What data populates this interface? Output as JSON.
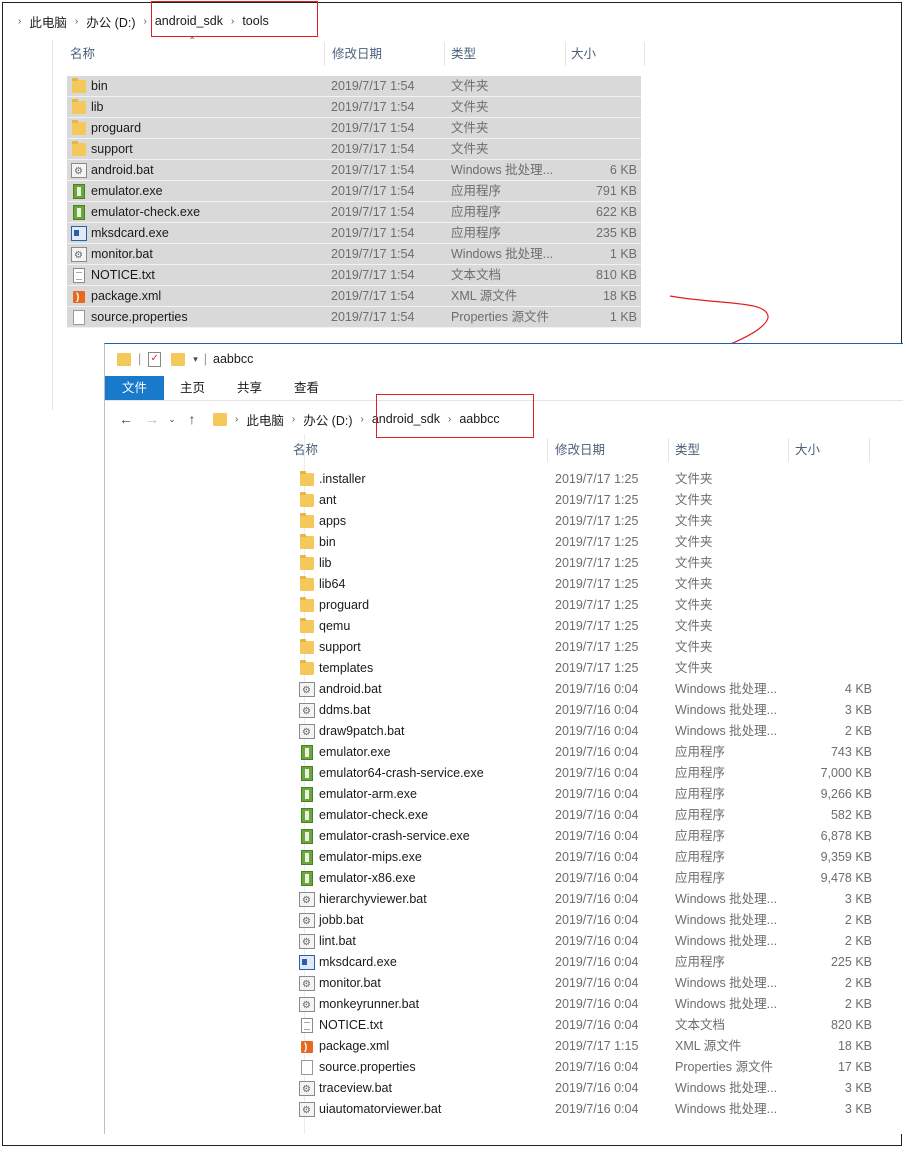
{
  "window1": {
    "breadcrumb": [
      "此电脑",
      "办公 (D:)",
      "android_sdk",
      "tools"
    ],
    "columns": {
      "name": "名称",
      "date": "修改日期",
      "type": "类型",
      "size": "大小"
    },
    "files": [
      {
        "icon": "folder",
        "name": "bin",
        "date": "2019/7/17 1:54",
        "type": "文件夹",
        "size": ""
      },
      {
        "icon": "folder",
        "name": "lib",
        "date": "2019/7/17 1:54",
        "type": "文件夹",
        "size": ""
      },
      {
        "icon": "folder",
        "name": "proguard",
        "date": "2019/7/17 1:54",
        "type": "文件夹",
        "size": ""
      },
      {
        "icon": "folder",
        "name": "support",
        "date": "2019/7/17 1:54",
        "type": "文件夹",
        "size": ""
      },
      {
        "icon": "bat",
        "name": "android.bat",
        "date": "2019/7/17 1:54",
        "type": "Windows 批处理...",
        "size": "6 KB"
      },
      {
        "icon": "exe",
        "name": "emulator.exe",
        "date": "2019/7/17 1:54",
        "type": "应用程序",
        "size": "791 KB"
      },
      {
        "icon": "exe",
        "name": "emulator-check.exe",
        "date": "2019/7/17 1:54",
        "type": "应用程序",
        "size": "622 KB"
      },
      {
        "icon": "exe2",
        "name": "mksdcard.exe",
        "date": "2019/7/17 1:54",
        "type": "应用程序",
        "size": "235 KB"
      },
      {
        "icon": "bat",
        "name": "monitor.bat",
        "date": "2019/7/17 1:54",
        "type": "Windows 批处理...",
        "size": "1 KB"
      },
      {
        "icon": "txt",
        "name": "NOTICE.txt",
        "date": "2019/7/17 1:54",
        "type": "文本文档",
        "size": "810 KB"
      },
      {
        "icon": "xml",
        "name": "package.xml",
        "date": "2019/7/17 1:54",
        "type": "XML 源文件",
        "size": "18 KB"
      },
      {
        "icon": "doc",
        "name": "source.properties",
        "date": "2019/7/17 1:54",
        "type": "Properties 源文件",
        "size": "1 KB"
      }
    ]
  },
  "window2": {
    "title": "aabbcc",
    "ribbon_tabs": [
      "文件",
      "主页",
      "共享",
      "查看"
    ],
    "breadcrumb": [
      "此电脑",
      "办公 (D:)",
      "android_sdk",
      "aabbcc"
    ],
    "columns": {
      "name": "名称",
      "date": "修改日期",
      "type": "类型",
      "size": "大小"
    },
    "files": [
      {
        "icon": "folder",
        "name": ".installer",
        "date": "2019/7/17 1:25",
        "type": "文件夹",
        "size": ""
      },
      {
        "icon": "folder",
        "name": "ant",
        "date": "2019/7/17 1:25",
        "type": "文件夹",
        "size": ""
      },
      {
        "icon": "folder",
        "name": "apps",
        "date": "2019/7/17 1:25",
        "type": "文件夹",
        "size": ""
      },
      {
        "icon": "folder",
        "name": "bin",
        "date": "2019/7/17 1:25",
        "type": "文件夹",
        "size": ""
      },
      {
        "icon": "folder",
        "name": "lib",
        "date": "2019/7/17 1:25",
        "type": "文件夹",
        "size": ""
      },
      {
        "icon": "folder",
        "name": "lib64",
        "date": "2019/7/17 1:25",
        "type": "文件夹",
        "size": ""
      },
      {
        "icon": "folder",
        "name": "proguard",
        "date": "2019/7/17 1:25",
        "type": "文件夹",
        "size": ""
      },
      {
        "icon": "folder",
        "name": "qemu",
        "date": "2019/7/17 1:25",
        "type": "文件夹",
        "size": ""
      },
      {
        "icon": "folder",
        "name": "support",
        "date": "2019/7/17 1:25",
        "type": "文件夹",
        "size": ""
      },
      {
        "icon": "folder",
        "name": "templates",
        "date": "2019/7/17 1:25",
        "type": "文件夹",
        "size": ""
      },
      {
        "icon": "bat",
        "name": "android.bat",
        "date": "2019/7/16 0:04",
        "type": "Windows 批处理...",
        "size": "4 KB"
      },
      {
        "icon": "bat",
        "name": "ddms.bat",
        "date": "2019/7/16 0:04",
        "type": "Windows 批处理...",
        "size": "3 KB"
      },
      {
        "icon": "bat",
        "name": "draw9patch.bat",
        "date": "2019/7/16 0:04",
        "type": "Windows 批处理...",
        "size": "2 KB"
      },
      {
        "icon": "exe",
        "name": "emulator.exe",
        "date": "2019/7/16 0:04",
        "type": "应用程序",
        "size": "743 KB"
      },
      {
        "icon": "exe",
        "name": "emulator64-crash-service.exe",
        "date": "2019/7/16 0:04",
        "type": "应用程序",
        "size": "7,000 KB"
      },
      {
        "icon": "exe",
        "name": "emulator-arm.exe",
        "date": "2019/7/16 0:04",
        "type": "应用程序",
        "size": "9,266 KB"
      },
      {
        "icon": "exe",
        "name": "emulator-check.exe",
        "date": "2019/7/16 0:04",
        "type": "应用程序",
        "size": "582 KB"
      },
      {
        "icon": "exe",
        "name": "emulator-crash-service.exe",
        "date": "2019/7/16 0:04",
        "type": "应用程序",
        "size": "6,878 KB"
      },
      {
        "icon": "exe",
        "name": "emulator-mips.exe",
        "date": "2019/7/16 0:04",
        "type": "应用程序",
        "size": "9,359 KB"
      },
      {
        "icon": "exe",
        "name": "emulator-x86.exe",
        "date": "2019/7/16 0:04",
        "type": "应用程序",
        "size": "9,478 KB"
      },
      {
        "icon": "bat",
        "name": "hierarchyviewer.bat",
        "date": "2019/7/16 0:04",
        "type": "Windows 批处理...",
        "size": "3 KB"
      },
      {
        "icon": "bat",
        "name": "jobb.bat",
        "date": "2019/7/16 0:04",
        "type": "Windows 批处理...",
        "size": "2 KB"
      },
      {
        "icon": "bat",
        "name": "lint.bat",
        "date": "2019/7/16 0:04",
        "type": "Windows 批处理...",
        "size": "2 KB"
      },
      {
        "icon": "exe2",
        "name": "mksdcard.exe",
        "date": "2019/7/16 0:04",
        "type": "应用程序",
        "size": "225 KB"
      },
      {
        "icon": "bat",
        "name": "monitor.bat",
        "date": "2019/7/16 0:04",
        "type": "Windows 批处理...",
        "size": "2 KB"
      },
      {
        "icon": "bat",
        "name": "monkeyrunner.bat",
        "date": "2019/7/16 0:04",
        "type": "Windows 批处理...",
        "size": "2 KB"
      },
      {
        "icon": "txt",
        "name": "NOTICE.txt",
        "date": "2019/7/16 0:04",
        "type": "文本文档",
        "size": "820 KB"
      },
      {
        "icon": "xml",
        "name": "package.xml",
        "date": "2019/7/17 1:15",
        "type": "XML 源文件",
        "size": "18 KB"
      },
      {
        "icon": "doc",
        "name": "source.properties",
        "date": "2019/7/16 0:04",
        "type": "Properties 源文件",
        "size": "17 KB"
      },
      {
        "icon": "bat",
        "name": "traceview.bat",
        "date": "2019/7/16 0:04",
        "type": "Windows 批处理...",
        "size": "3 KB"
      },
      {
        "icon": "bat",
        "name": "uiautomatorviewer.bat",
        "date": "2019/7/16 0:04",
        "type": "Windows 批处理...",
        "size": "3 KB"
      }
    ]
  },
  "colors": {
    "annotation": "#e02020",
    "selection": "#d9d9d9",
    "ribbon_active": "#1979ca"
  }
}
